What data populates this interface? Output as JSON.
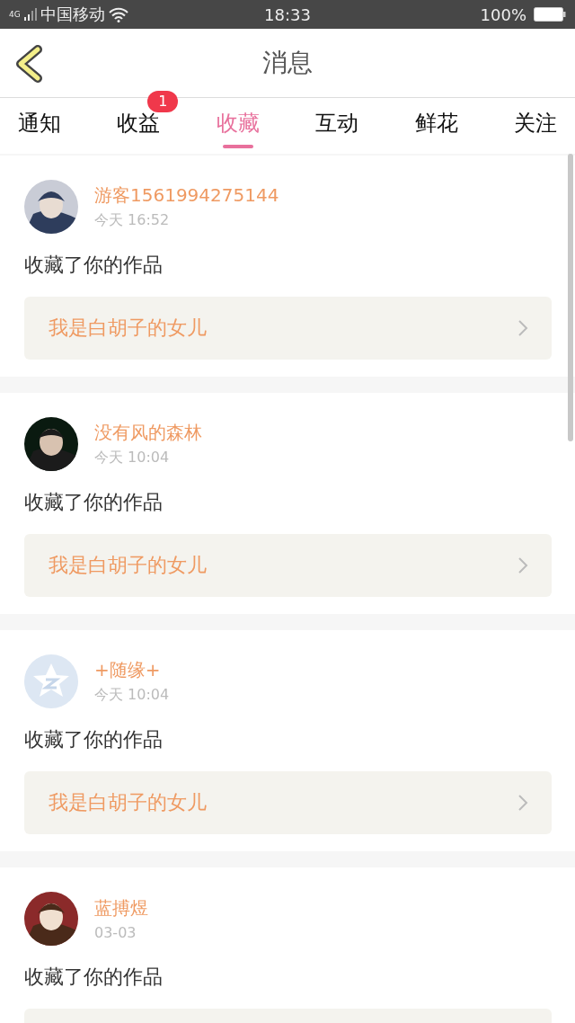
{
  "status_bar": {
    "network": "4G",
    "carrier": "中国移动",
    "time": "18:33",
    "battery": "100%"
  },
  "header": {
    "title": "消息"
  },
  "tabs": [
    {
      "label": "通知",
      "selected": false
    },
    {
      "label": "收益",
      "selected": false,
      "badge": "1"
    },
    {
      "label": "收藏",
      "selected": true
    },
    {
      "label": "互动",
      "selected": false
    },
    {
      "label": "鲜花",
      "selected": false
    },
    {
      "label": "关注",
      "selected": false
    }
  ],
  "messages": [
    {
      "kind": "picture",
      "name": "游客1561994275144",
      "time": "今天 16:52",
      "action": "收藏了你的作品",
      "work": "我是白胡子的女儿"
    },
    {
      "kind": "picture",
      "name": "没有风的森林",
      "time": "今天 10:04",
      "action": "收藏了你的作品",
      "work": "我是白胡子的女儿"
    },
    {
      "kind": "default",
      "name": "+随缘+",
      "time": "今天 10:04",
      "action": "收藏了你的作品",
      "work": "我是白胡子的女儿"
    },
    {
      "kind": "picture",
      "name": "蓝搏煜",
      "time": "03-03",
      "action": "收藏了你的作品"
    }
  ]
}
